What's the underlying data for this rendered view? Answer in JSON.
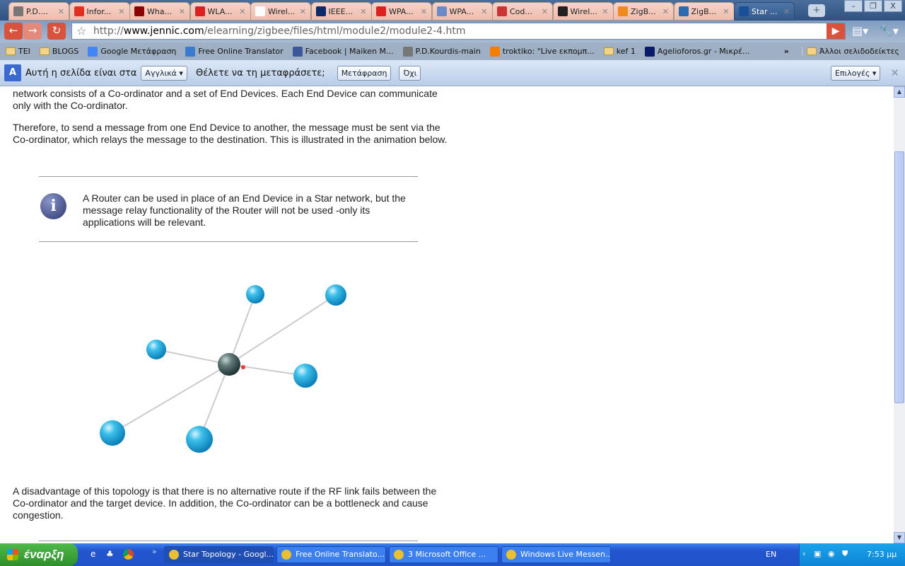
{
  "tabs": [
    {
      "title": "P.D....",
      "color": "#777"
    },
    {
      "title": "Infor...",
      "color": "#e03020"
    },
    {
      "title": "Wha...",
      "color": "#8b0000"
    },
    {
      "title": "WLA...",
      "color": "#dd2020"
    },
    {
      "title": "Wirel...",
      "color": "#ffffff"
    },
    {
      "title": "IEEE...",
      "color": "#0a2a6a"
    },
    {
      "title": "WPA...",
      "color": "#e02020"
    },
    {
      "title": "WPA...",
      "color": "#6a8ac8"
    },
    {
      "title": "Cod...",
      "color": "#cc3333"
    },
    {
      "title": "Wirel...",
      "color": "#222222"
    },
    {
      "title": "ZigB...",
      "color": "#f08a20"
    },
    {
      "title": "ZigB...",
      "color": "#2a6ab0"
    },
    {
      "title": "Star ...",
      "color": "#1a4f9a",
      "active": true
    }
  ],
  "window": {
    "minimize": "–",
    "restore": "❐",
    "close": "X"
  },
  "toolbar": {
    "url_prefix": "http://",
    "url_host": "www.jennic.com",
    "url_path": "/elearning/zigbee/files/html/module2/module2-4.htm"
  },
  "bookmarks": [
    {
      "label": "TEI",
      "type": "folder"
    },
    {
      "label": "BLOGS",
      "type": "folder"
    },
    {
      "label": "Google Μετάφραση",
      "type": "site",
      "color": "#4285f4"
    },
    {
      "label": "Free Online Translator",
      "type": "site",
      "color": "#3a7ad0"
    },
    {
      "label": "Facebook | Maiken M...",
      "type": "site",
      "color": "#3b5998"
    },
    {
      "label": "P.D.Kourdis-main",
      "type": "site",
      "color": "#777"
    },
    {
      "label": "troktiko: \"Live εκπομπ...",
      "type": "site",
      "color": "#f57d00"
    },
    {
      "label": "kef 1",
      "type": "folder"
    },
    {
      "label": "Agelioforos.gr - Μικρέ...",
      "type": "site",
      "color": "#0a1a6a"
    }
  ],
  "bookmarks_more": "»",
  "other_bookmarks": "Άλλοι σελιδοδείκτες",
  "translate": {
    "text1": "Αυτή η σελίδα είναι στα",
    "language": "Αγγλικά",
    "text2": "Θέλετε να τη μεταφράσετε;",
    "translate_btn": "Μετάφραση",
    "no_btn": "Όχι",
    "options_btn": "Επιλογές",
    "close": "✕"
  },
  "content": {
    "p1": "network consists of a Co-ordinator and a set of End Devices. Each End Device can communicate only with the Co-ordinator.",
    "p2": "Therefore, to send a message from one End Device to another, the message must be sent via the Co-ordinator, which relays the message to the destination. This is illustrated in the animation below.",
    "note": "A Router can be used in place of an End Device in a Star network, but the message relay functionality of the Router will not be used -only its applications will be relevant.",
    "p3": "A disadvantage of this topology is that there is no alternative route if the RF link fails between the Co-ordinator and the target device. In addition, the Co-ordinator can be a bottleneck and cause congestion."
  },
  "taskbar": {
    "start": "έναρξη",
    "more": "»",
    "tasks": [
      {
        "label": "Star Topology - Googl...",
        "active": true
      },
      {
        "label": "Free Online Translato..."
      },
      {
        "label": "3 Microsoft Office ..."
      },
      {
        "label": "Windows Live Messen..."
      }
    ],
    "lang": "EN",
    "time": "7:53 μμ"
  }
}
